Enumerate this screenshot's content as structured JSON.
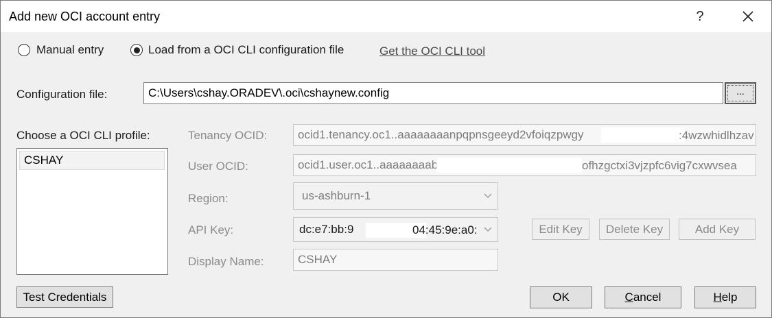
{
  "window": {
    "title": "Add new OCI account entry",
    "help_label": "?",
    "close_icon": "close-icon"
  },
  "source": {
    "manual_label": "Manual entry",
    "config_label": "Load from a OCI CLI configuration file",
    "selected": "config",
    "get_tool_link": "Get the OCI CLI tool"
  },
  "config_file": {
    "label": "Configuration file:",
    "value": "C:\\Users\\cshay.ORADEV\\.oci\\cshaynew.config",
    "browse_label": "..."
  },
  "profiles": {
    "label": "Choose a OCI CLI profile:",
    "items": [
      "CSHAY"
    ]
  },
  "details": {
    "tenancy_label": "Tenancy OCID:",
    "tenancy_value_start": "ocid1.tenancy.oc1..aaaaaaaanpqpnsgeeyd2vfoiqzpwgy",
    "tenancy_value_end": ":4wzwhidlhzav",
    "user_label": "User OCID:",
    "user_value_start": "ocid1.user.oc1..aaaaaaaabt",
    "user_value_end": "ofhzgctxi3vjzpfc6vig7cxwvsea",
    "region_label": "Region:",
    "region_value": "us-ashburn-1",
    "apikey_label": "API Key:",
    "apikey_value_start": "dc:e7:bb:9",
    "apikey_value_end": "04:45:9e:a0:",
    "display_name_label": "Display Name:",
    "display_name_value": "CSHAY"
  },
  "key_buttons": {
    "edit": "Edit Key",
    "delete": "Delete Key",
    "add": "Add Key"
  },
  "footer": {
    "test_label": "Test Credentials",
    "ok_label": "OK",
    "cancel_first": "C",
    "cancel_rest": "ancel",
    "help_first": "H",
    "help_rest": "elp"
  },
  "colors": {
    "accent_border": "#7a7a7a",
    "disabled_text": "#8a8a8a",
    "window_bg": "#f0f0f0"
  }
}
